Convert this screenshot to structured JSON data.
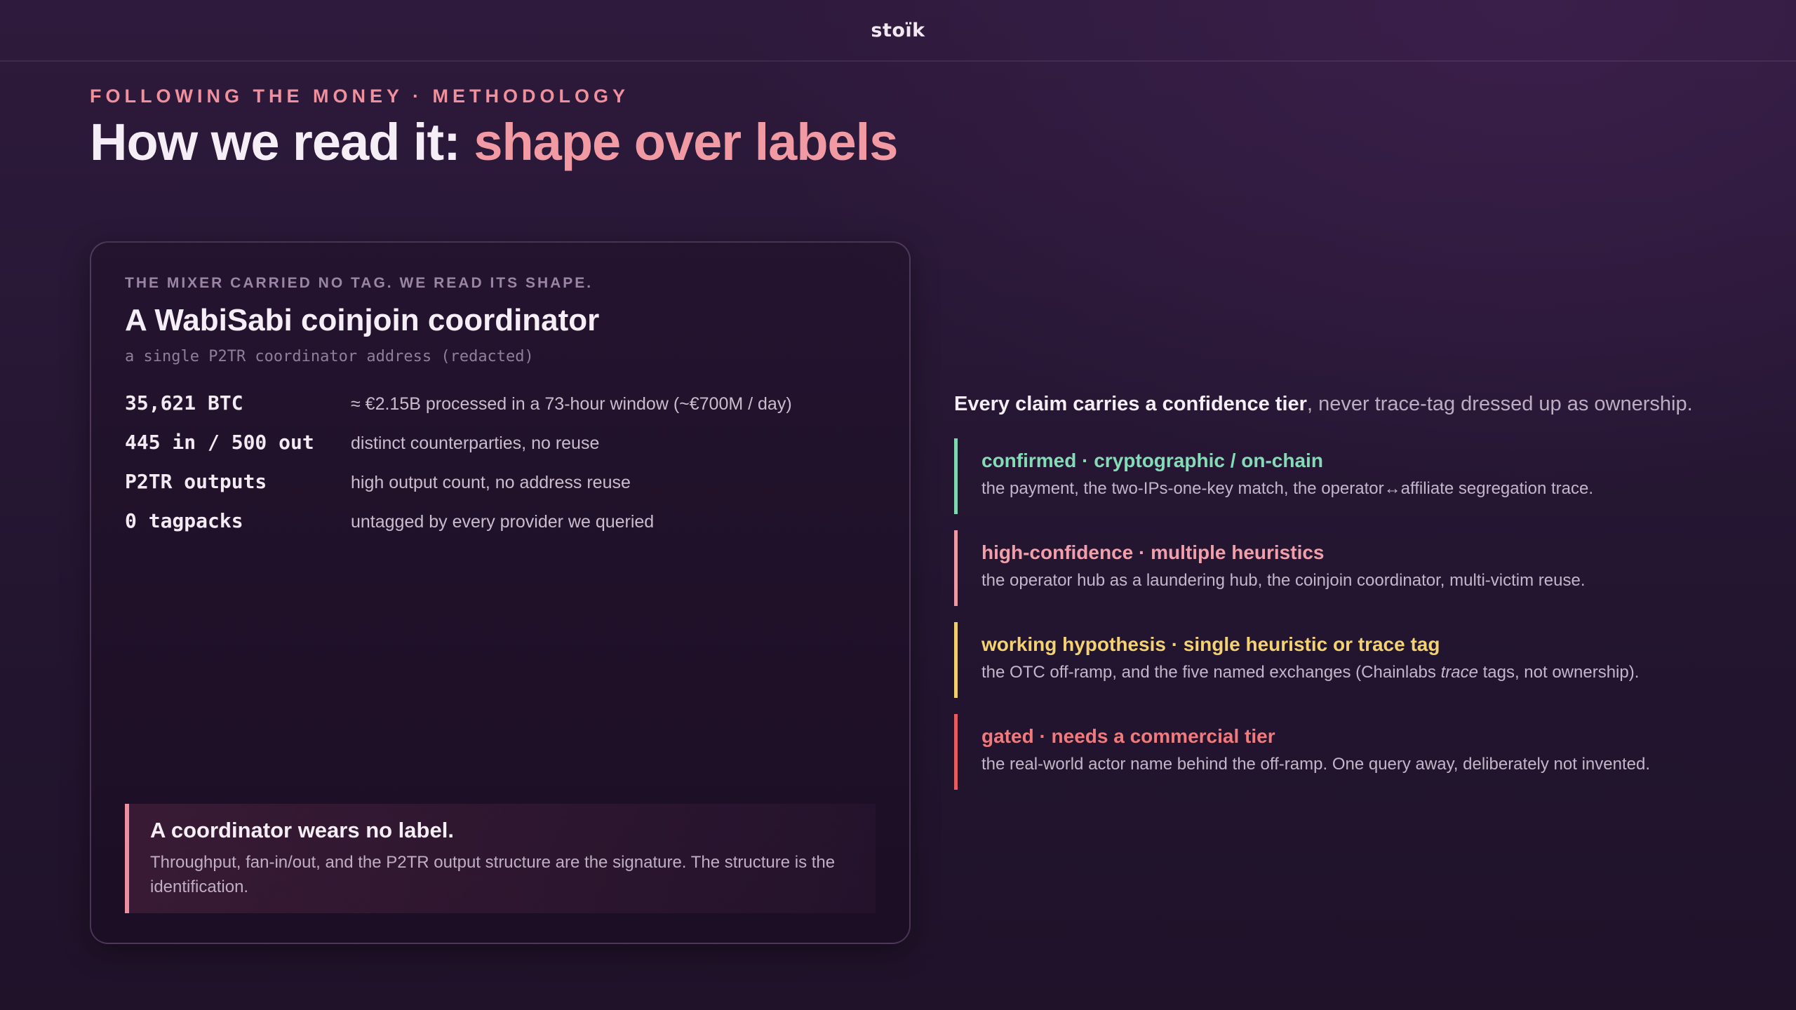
{
  "header": {
    "brand": "stoïk"
  },
  "hero": {
    "eyebrow": "FOLLOWING THE MONEY · METHODOLOGY",
    "title_lead": "How we read it: ",
    "title_accent": "shape over labels"
  },
  "card": {
    "eyebrow": "THE MIXER CARRIED NO TAG. WE READ ITS SHAPE.",
    "title": "A WabiSabi coinjoin coordinator",
    "subtitle": "a single P2TR coordinator address (redacted)",
    "stats": [
      {
        "key": "35,621 BTC",
        "value": "≈ €2.15B processed in a 73-hour window (~€700M / day)"
      },
      {
        "key": "445 in / 500 out",
        "value": "distinct counterparties, no reuse"
      },
      {
        "key": "P2TR outputs",
        "value": "high output count, no address reuse"
      },
      {
        "key": "0 tagpacks",
        "value": "untagged by every provider we queried"
      }
    ],
    "callout": {
      "title": "A coordinator wears no label.",
      "body": "Throughput, fan-in/out, and the P2TR output structure are the signature. The structure is the identification."
    }
  },
  "tiers": {
    "intro_strong": "Every claim carries a confidence tier",
    "intro_rest": ", never trace-tag dressed up as ownership.",
    "items": [
      {
        "title": "confirmed · cryptographic / on-chain",
        "desc": "the payment, the two-IPs-one-key match, the operator↔affiliate segregation trace."
      },
      {
        "title": "high-confidence · multiple heuristics",
        "desc": "the operator hub as a laundering hub, the coinjoin coordinator, multi-victim reuse."
      },
      {
        "title": "working hypothesis · single heuristic or trace tag",
        "desc_before": "the OTC off-ramp, and the five named exchanges (Chainlabs ",
        "desc_em": "trace",
        "desc_after": " tags, not ownership)."
      },
      {
        "title": "gated · needs a commercial tier",
        "desc": "the real-world actor name behind the off-ramp. One query away, deliberately not invented."
      }
    ]
  },
  "colors": {
    "accent": "#f29aa4",
    "confirmed": "#84dcb6",
    "high_confidence": "#f1a0ab",
    "hypothesis": "#f4d271",
    "gated": "#f07a7c"
  }
}
